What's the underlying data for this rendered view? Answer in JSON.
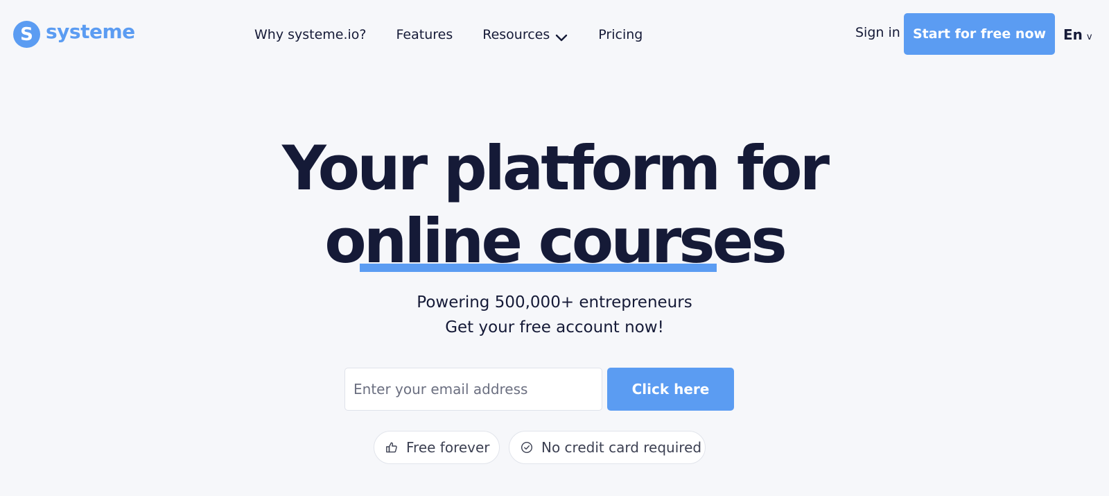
{
  "brand": {
    "logo_letter": "S",
    "name": "systeme",
    "color": "#5b9cf2"
  },
  "nav": {
    "items": [
      {
        "label": "Why systeme.io?"
      },
      {
        "label": "Features"
      },
      {
        "label": "Resources",
        "icon": "chevron-down-icon"
      },
      {
        "label": "Pricing"
      }
    ]
  },
  "header": {
    "signin_label": "Sign in",
    "cta_label": "Start for free now",
    "language": "En",
    "language_caret": "v"
  },
  "hero": {
    "line1": "Your platform for",
    "line2": "online courses",
    "sub1": "Powering 500,000+ entrepreneurs",
    "sub2": "Get your free account now!"
  },
  "form": {
    "email_placeholder": "Enter your email address",
    "email_value": "",
    "submit_label": "Click here"
  },
  "badges": [
    {
      "label": "Free forever",
      "icon": "thumbs-up-icon"
    },
    {
      "label": "No credit card required",
      "icon": "check-circle-icon"
    }
  ],
  "colors": {
    "background": "#f6f7fa",
    "text": "#151a37",
    "accent": "#5b9cf2"
  }
}
